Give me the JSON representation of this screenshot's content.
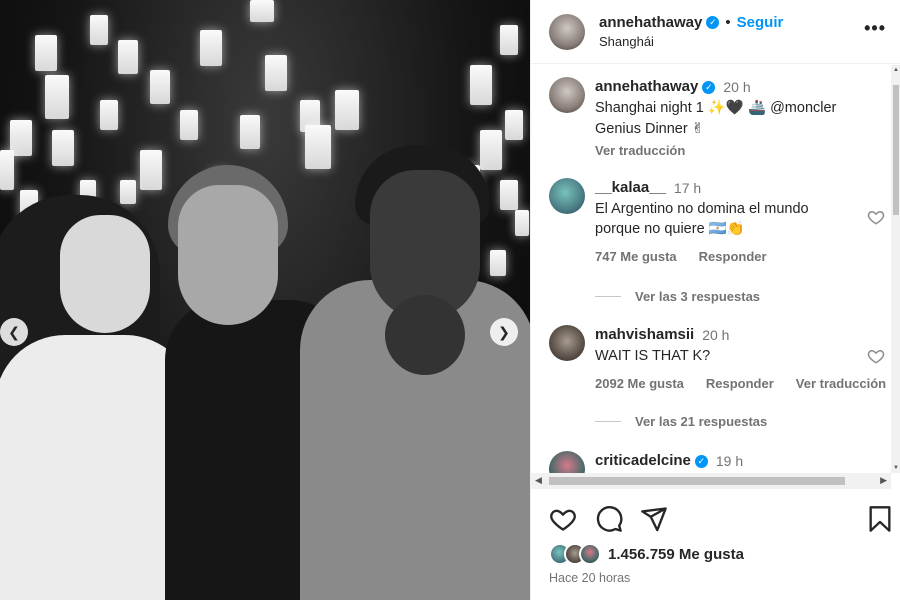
{
  "post": {
    "username": "annehathaway",
    "follow_label": "Seguir",
    "location": "Shanghái",
    "caption_time": "20 h",
    "caption_line1": "Shanghai night 1 ✨🖤 🚢 @moncler",
    "caption_line2": "Genius Dinner ✌",
    "see_translation": "Ver traducción"
  },
  "comments": [
    {
      "username": "__kalaa__",
      "time": "17 h",
      "text": "El Argentino no domina el mundo porque no quiere 🇦🇷👏",
      "likes": "747 Me gusta",
      "reply": "Responder",
      "translate": "",
      "view_replies": "Ver las 3 respuestas"
    },
    {
      "username": "mahvishamsii",
      "time": "20 h",
      "text": "WAIT IS THAT K?",
      "likes": "2092 Me gusta",
      "reply": "Responder",
      "translate": "Ver traducción",
      "view_replies": "Ver las 21 respuestas"
    },
    {
      "username": "criticadelcine",
      "time": "19 h",
      "text": "",
      "likes": "",
      "reply": "",
      "translate": "",
      "view_replies": ""
    }
  ],
  "footer": {
    "likes_count": "1.456.759 Me gusta",
    "posted_time": "Hace 20 horas"
  },
  "icons": {
    "more": "more-options-icon",
    "like": "heart-icon",
    "comment": "comment-bubble-icon",
    "share": "paper-plane-icon",
    "save": "bookmark-icon",
    "verified": "verified-badge-icon",
    "prev": "chevron-left-icon",
    "next": "chevron-right-icon"
  },
  "colors": {
    "accent": "#0095f6",
    "secondary_text": "#737373",
    "primary_text": "#262626"
  }
}
